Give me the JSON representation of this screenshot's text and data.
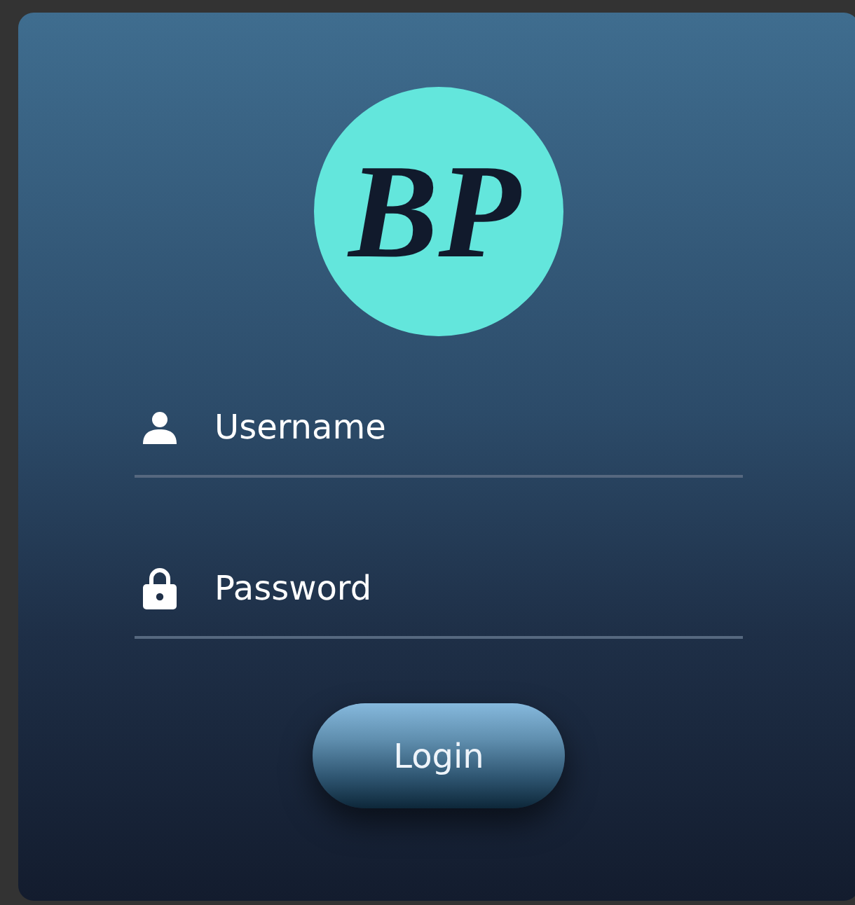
{
  "logo": {
    "text": "BP"
  },
  "fields": [
    {
      "kind": "user",
      "placeholder": "Username"
    },
    {
      "kind": "password",
      "placeholder": "Password"
    }
  ],
  "button": {
    "label": "Login"
  }
}
